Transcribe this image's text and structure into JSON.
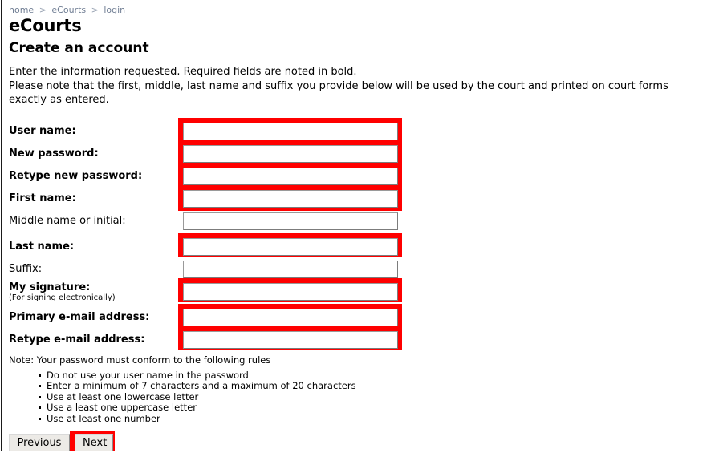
{
  "breadcrumb": {
    "items": [
      {
        "label": "home"
      },
      {
        "label": "eCourts"
      },
      {
        "label": "login"
      }
    ],
    "separator": ">"
  },
  "header": {
    "site_title": "eCourts",
    "page_title": "Create an account"
  },
  "intro": {
    "line1": "Enter the information requested. Required fields are noted in bold.",
    "line2": "Please note that the first, middle, last name and suffix you provide below will be used by the court and printed on court forms exactly as entered."
  },
  "form": {
    "fields": [
      {
        "label": "User name:",
        "required": true,
        "value": "",
        "highlight": true
      },
      {
        "label": "New password:",
        "required": true,
        "value": "",
        "highlight": true
      },
      {
        "label": "Retype new password:",
        "required": true,
        "value": "",
        "highlight": true
      },
      {
        "label": "First name:",
        "required": true,
        "value": "",
        "highlight": true
      },
      {
        "label": "Middle name or initial:",
        "required": false,
        "value": "",
        "highlight": false
      },
      {
        "label": "Last name:",
        "required": true,
        "value": "",
        "highlight": true
      },
      {
        "label": "Suffix:",
        "required": false,
        "value": "",
        "highlight": false
      },
      {
        "label": "My signature:",
        "sub_label": "(For signing electronically)",
        "required": true,
        "value": "",
        "highlight": true
      },
      {
        "label": "Primary e-mail address:",
        "required": true,
        "value": "",
        "highlight": true
      },
      {
        "label": "Retype e-mail address:",
        "required": true,
        "value": "",
        "highlight": true
      }
    ]
  },
  "password_rules": {
    "note": "Note: Your password must conform to the following rules",
    "items": [
      "Do not use your user name in the password",
      "Enter a minimum of 7 characters and a maximum of 20 characters",
      "Use at least one lowercase letter",
      "Use a least one uppercase letter",
      "Use at least one number"
    ]
  },
  "buttons": {
    "previous": "Previous",
    "next": "Next"
  },
  "colors": {
    "highlight": "#ff0000",
    "text": "#000000",
    "breadcrumb_link": "#6f7d93",
    "field_border": "#9a9a9a",
    "button_face": "#eceae6"
  }
}
